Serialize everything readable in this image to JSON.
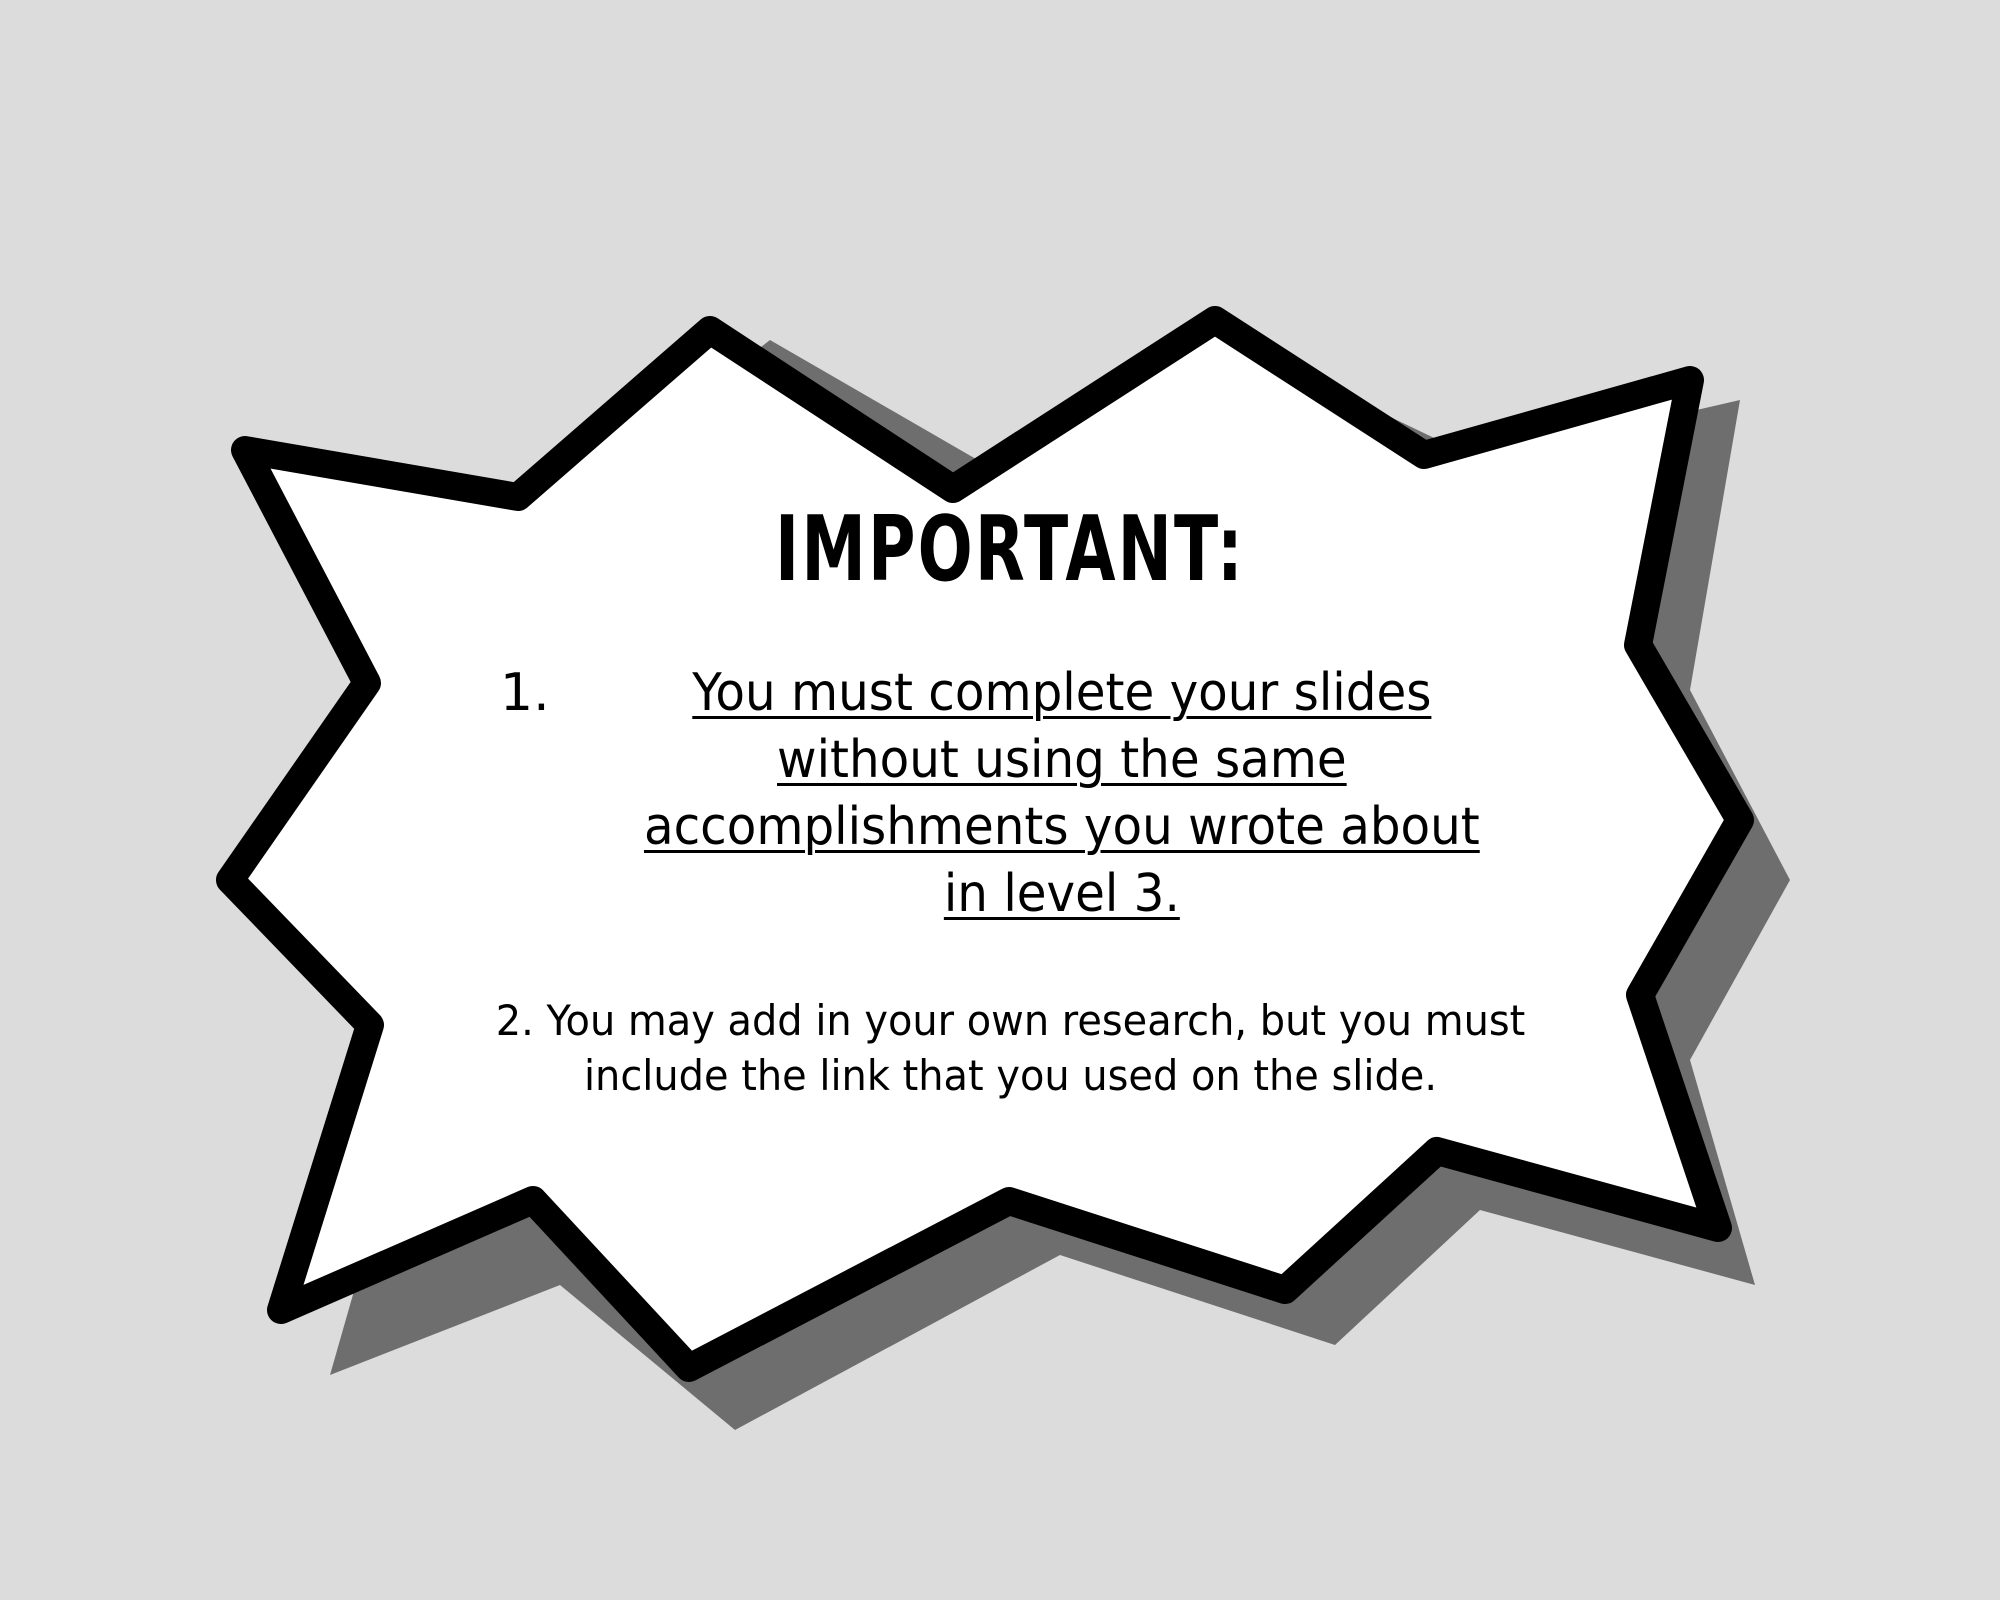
{
  "callout": {
    "title": "IMPORTANT:",
    "item_1_number": "1.",
    "item_1_text": "You must complete your slides without using the same accomplishments you wrote about in level 3.",
    "item_2_text": "2. You may add in your own research, but you must include the link that you used on the slide."
  },
  "colors": {
    "background": "#dcdcdc",
    "burst_fill": "#ffffff",
    "burst_outline": "#000000",
    "shadow": "#6e6e6e",
    "text": "#000000"
  }
}
